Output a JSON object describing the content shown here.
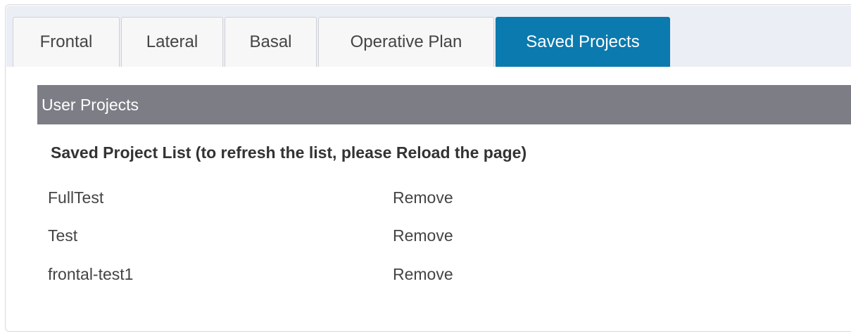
{
  "tabs": [
    {
      "label": "Frontal",
      "active": false
    },
    {
      "label": "Lateral",
      "active": false
    },
    {
      "label": "Basal",
      "active": false
    },
    {
      "label": "Operative Plan",
      "active": false
    },
    {
      "label": "Saved Projects",
      "active": true
    }
  ],
  "section": {
    "header": "User Projects",
    "list_title": "Saved Project List (to refresh the list, please Reload the page)"
  },
  "projects": [
    {
      "name": "FullTest",
      "action": "Remove"
    },
    {
      "name": "Test",
      "action": "Remove"
    },
    {
      "name": "frontal-test1",
      "action": "Remove"
    }
  ],
  "colors": {
    "active_tab": "#0a7aaf",
    "tabbar_bg": "#eceef5",
    "section_header_bg": "#7c7d85"
  }
}
